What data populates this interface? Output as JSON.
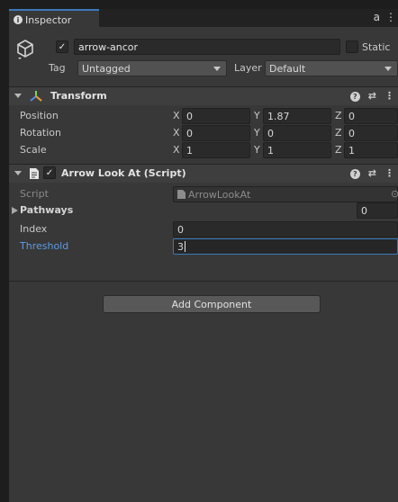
{
  "tab": {
    "title": "Inspector",
    "lock_glyph": "a",
    "menu_glyph": "⋮"
  },
  "object": {
    "active": true,
    "name": "arrow-ancor",
    "static_label": "Static",
    "tag_label": "Tag",
    "tag_value": "Untagged",
    "layer_label": "Layer",
    "layer_value": "Default"
  },
  "transform": {
    "title": "Transform",
    "rows": [
      {
        "label": "Position",
        "x": "0",
        "y": "1.87",
        "z": "0"
      },
      {
        "label": "Rotation",
        "x": "0",
        "y": "0",
        "z": "0"
      },
      {
        "label": "Scale",
        "x": "1",
        "y": "1",
        "z": "1"
      }
    ],
    "axis_labels": {
      "x": "X",
      "y": "Y",
      "z": "Z"
    }
  },
  "script_component": {
    "title": "Arrow Look At (Script)",
    "enabled": true,
    "script_label": "Script",
    "script_value": "ArrowLookAt",
    "pathways_label": "Pathways",
    "pathways_value": "0",
    "index_label": "Index",
    "index_value": "0",
    "threshold_label": "Threshold",
    "threshold_value": "3"
  },
  "add_component_label": "Add Component",
  "colors": {
    "panel_bg": "#383838",
    "field_bg": "#2a2a2a",
    "accent": "#3a79bb",
    "modified_label": "#5d9ce6"
  },
  "icons": [
    "info-icon",
    "lock-icon",
    "menu-icon",
    "gameobject-cube-icon",
    "transform-axes-icon",
    "script-file-icon",
    "help-icon",
    "settings-sliders-icon",
    "object-picker-icon"
  ]
}
